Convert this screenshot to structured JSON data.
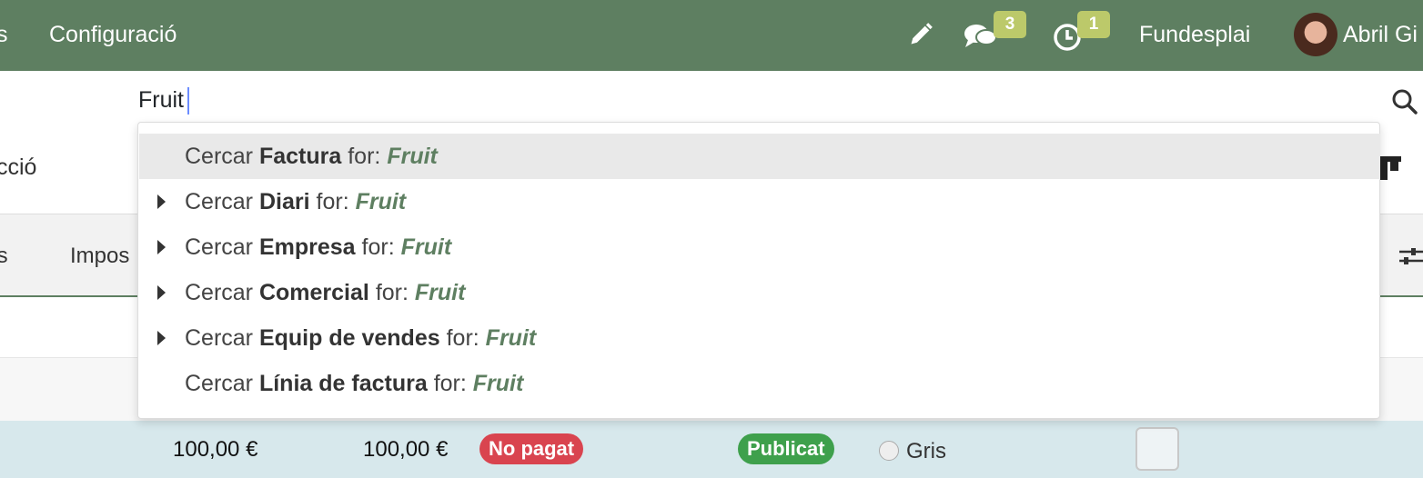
{
  "navbar": {
    "prev_menu_fragment": "s",
    "config_label": "Configuració",
    "messages_count": "3",
    "activities_count": "1",
    "company": "Fundesplai",
    "user_name": "Abril Gi"
  },
  "search": {
    "value": "Fruit"
  },
  "page": {
    "control_panel_fragment": "cció",
    "filter_prev_fragment": "ts",
    "filter_impos_fragment": "Impos"
  },
  "row": {
    "amount_untaxed": "100,00 €",
    "amount_total": "100,00 €",
    "payment_status": "No pagat",
    "state": "Publicat",
    "color_label": "Gris"
  },
  "dropdown": {
    "prefix": "Cercar",
    "for_word": "for:",
    "query": "Fruit",
    "items": [
      {
        "field": "Factura",
        "expandable": false,
        "active": true
      },
      {
        "field": "Diari",
        "expandable": true,
        "active": false
      },
      {
        "field": "Empresa",
        "expandable": true,
        "active": false
      },
      {
        "field": "Comercial",
        "expandable": true,
        "active": false
      },
      {
        "field": "Equip de vendes",
        "expandable": true,
        "active": false
      },
      {
        "field": "Línia de factura",
        "expandable": false,
        "active": false
      }
    ]
  },
  "colors": {
    "brand": "#5e7f61",
    "badge": "#bcc96a",
    "danger": "#d9444f",
    "success": "#3ea04c"
  }
}
